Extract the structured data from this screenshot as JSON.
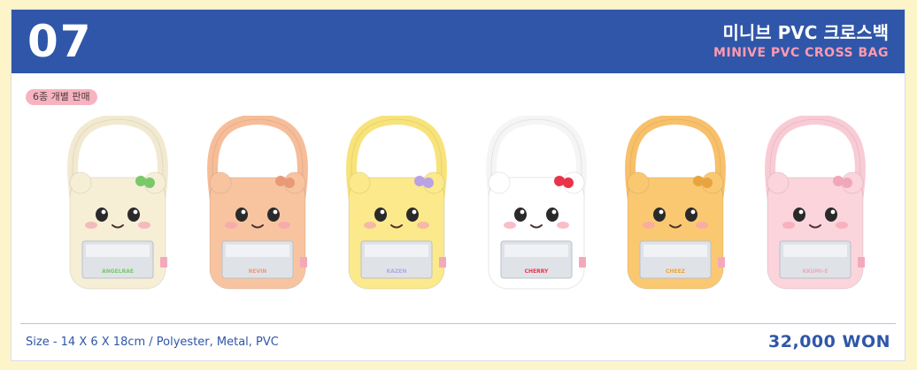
{
  "header": {
    "number": "07",
    "title_ko": "미니브 PVC 크로스백",
    "title_en": "MINIVE PVC CROSS BAG"
  },
  "badge": "6종 개별 판매",
  "bags": [
    {
      "label": "ANGELRAE",
      "body": "#f6efd6",
      "strap": "#f2ead0",
      "accent": "#7bc86a"
    },
    {
      "label": "REVIN",
      "body": "#f8c4a0",
      "strap": "#f6bd98",
      "accent": "#e89a76"
    },
    {
      "label": "KAZEN",
      "body": "#fbe98c",
      "strap": "#f8e37a",
      "accent": "#b9a2e6"
    },
    {
      "label": "CHERRY",
      "body": "#ffffff",
      "strap": "#f5f5f5",
      "accent": "#e8334a"
    },
    {
      "label": "CHEEZ",
      "body": "#fbc872",
      "strap": "#f8c06a",
      "accent": "#e8a440"
    },
    {
      "label": "KKUMI-E",
      "body": "#fbd4dc",
      "strap": "#f9cbd4",
      "accent": "#f0a8b8"
    }
  ],
  "footer": {
    "spec": "Size - 14 X 6 X 18cm / Polyester, Metal, PVC",
    "price": "32,000 WON"
  },
  "colors": {
    "header_bg": "#2f56a8",
    "page_bg": "#fdf5c9",
    "title_en": "#ff9ab0"
  }
}
